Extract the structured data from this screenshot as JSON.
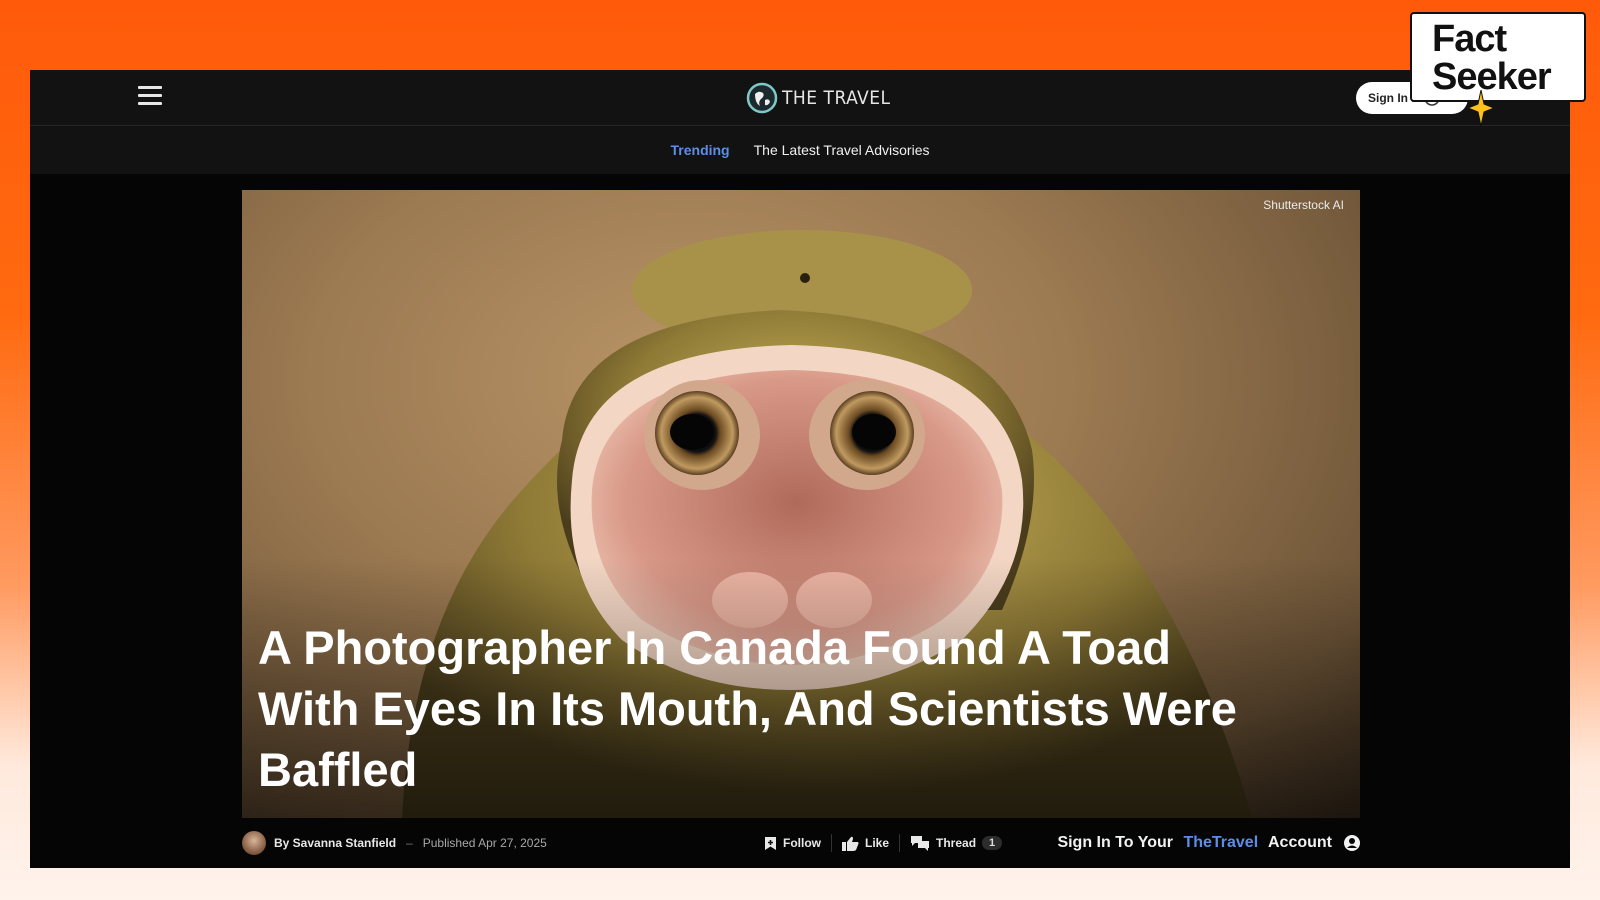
{
  "header": {
    "logo_text": "THE TRAVEL",
    "signin_label": "Sign In N"
  },
  "trending": {
    "label": "Trending",
    "link": "The Latest Travel Advisories"
  },
  "hero": {
    "image_credit": "Shutterstock AI",
    "headline": "A Photographer In Canada Found A Toad With Eyes In Its Mouth, And Scientists Were Baffled"
  },
  "meta": {
    "author": "By Savanna Stanfield",
    "separator": "–",
    "published": "Published Apr 27, 2025",
    "actions": {
      "follow": "Follow",
      "like": "Like",
      "thread": "Thread",
      "thread_count": "1"
    },
    "account_cta": {
      "prefix": "Sign In To Your ",
      "brand": "TheTravel",
      "suffix": " Account"
    }
  },
  "watermark": {
    "line1": "Fact",
    "line2": "Seeker"
  },
  "colors": {
    "accent_blue": "#5b8ee8",
    "background_orange": "#ff5a0a",
    "header_bg": "#121212"
  }
}
